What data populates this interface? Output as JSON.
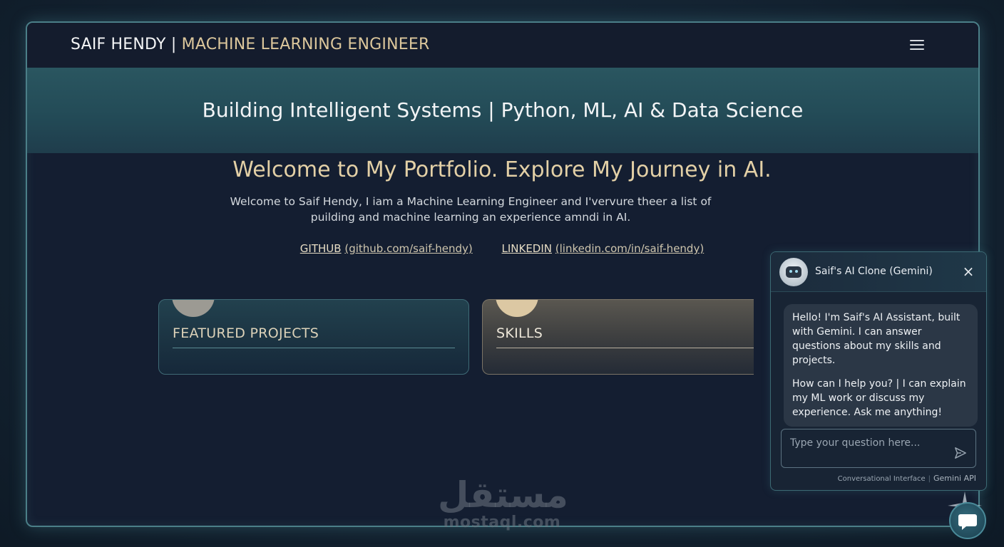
{
  "navbar": {
    "name": "SAIF HENDY",
    "separator": "|",
    "role": "MACHINE LEARNING ENGINEER",
    "menu_icon": "hamburger-menu-icon"
  },
  "hero": {
    "tagline": "Building Intelligent Systems | Python, ML, AI & Data Science"
  },
  "main": {
    "title": "Welcome to My Portfolio. Explore My Journey in AI.",
    "intro": "Welcome to Saif Hendy, I iam a Machine Learning Engineer and I'vervure theer a list of puilding and machine learning an experience amndi in AI.",
    "links": [
      {
        "label": "GITHUB",
        "url_text": "(github.com/saif-hendy)"
      },
      {
        "label": "LINKEDIN",
        "url_text": "(linkedin.com/in/saif-hendy)"
      }
    ],
    "cards": [
      {
        "title": "FEATURED PROJECTS"
      },
      {
        "title": "SKILLS"
      }
    ]
  },
  "chat": {
    "title": "Saif's AI Clone (Gemini)",
    "avatar_icon": "robot-avatar-icon",
    "close_icon": "close-icon",
    "messages": [
      "Hello! I'm Saif's AI Assistant, built with Gemini. I can answer questions about my skills and projects.",
      "How can I help you? | I can explain my ML work or discuss my experience. Ask me anything!"
    ],
    "input_placeholder": "Type your question here...",
    "send_icon": "send-icon",
    "footer_left": "Conversational Interface",
    "footer_sep": "|",
    "footer_right": "Gemini API"
  },
  "watermark": {
    "arabic": "مستقل",
    "latin": "mostaql.com"
  },
  "fab": {
    "icon": "chat-bubble-icon"
  },
  "colors": {
    "accent_gold": "#dcc79c",
    "teal_band": "#2a5660",
    "background": "#141e31",
    "border_teal": "#4b7f88"
  }
}
